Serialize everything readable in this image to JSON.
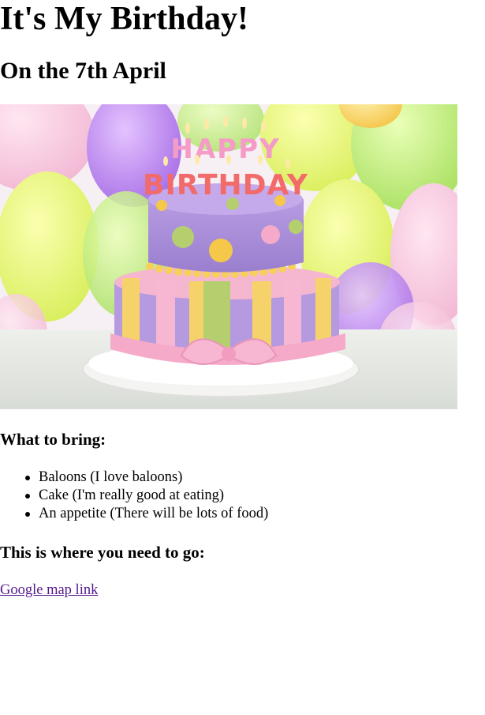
{
  "page": {
    "title": "It's My Birthday!",
    "subtitle": "On the 7th April"
  },
  "image": {
    "description_icon": "birthday-cake-image",
    "candle_text_line1": "HAPPY",
    "candle_text_line2": "BIRTHDAY"
  },
  "bring": {
    "heading": "What to bring:",
    "items": [
      "Baloons (I love baloons)",
      "Cake (I'm really good at eating)",
      "An appetite (There will be lots of food)"
    ]
  },
  "location": {
    "heading": "This is where you need to go:",
    "link_text": "Google map link"
  },
  "colors": {
    "link_visited": "#551a8b",
    "cake_purple": "#a98bd6",
    "cake_pink": "#f7b6d2",
    "cake_yellow": "#f5d36a",
    "cake_green": "#b5cf6e"
  }
}
